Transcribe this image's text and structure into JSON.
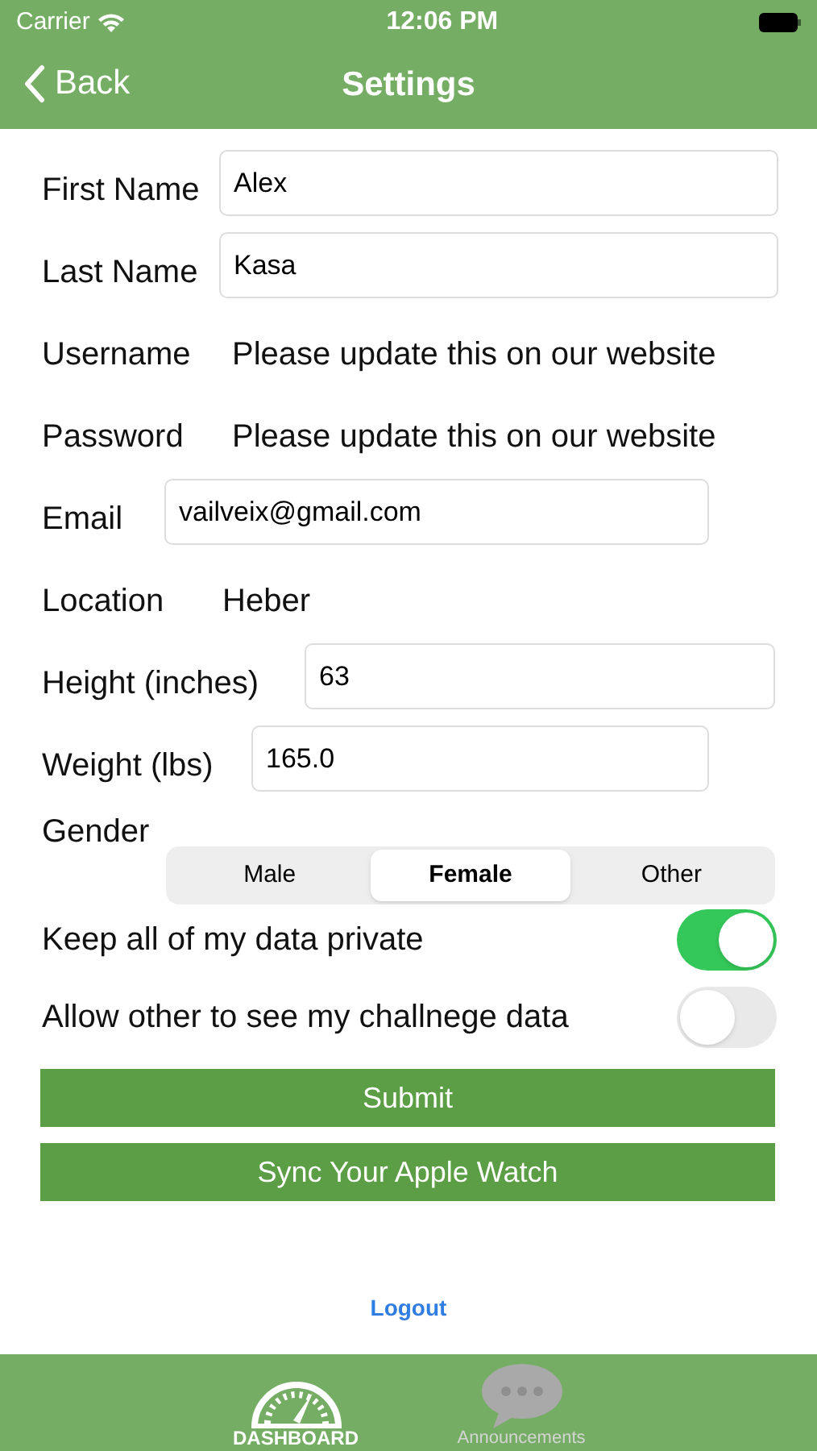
{
  "status_bar": {
    "carrier": "Carrier",
    "time": "12:06 PM"
  },
  "nav": {
    "back": "Back",
    "title": "Settings"
  },
  "fields": [
    {
      "kind": "input",
      "label": "First Name",
      "value": "Alex"
    },
    {
      "kind": "input",
      "label": "Last Name",
      "value": "Kasa"
    },
    {
      "kind": "text",
      "label": "Username",
      "value": "Please update this on our website"
    },
    {
      "kind": "text",
      "label": "Password",
      "value": "Please update this on our website"
    },
    {
      "kind": "input",
      "label": "Email",
      "value": "vailveix@gmail.com"
    },
    {
      "kind": "text",
      "label": "Location",
      "value": "Heber"
    },
    {
      "kind": "input",
      "label": "Height (inches)",
      "value": "63"
    },
    {
      "kind": "input",
      "label": "Weight (lbs)",
      "value": "165.0"
    }
  ],
  "gender": {
    "label": "Gender",
    "options": [
      {
        "label": "Male",
        "selected": false
      },
      {
        "label": "Female",
        "selected": true
      },
      {
        "label": "Other",
        "selected": false
      }
    ]
  },
  "toggles": [
    {
      "label": "Keep all of my data private",
      "on": true
    },
    {
      "label": "Allow other to see my challnege data",
      "on": false
    }
  ],
  "buttons": [
    "Submit",
    "Sync Your Apple Watch"
  ],
  "logout": "Logout",
  "tab_bar": [
    {
      "kind": "dashboard",
      "label": "DASHBOARD",
      "selected": true
    },
    {
      "kind": "chat",
      "label": "Announcements",
      "selected": false
    }
  ]
}
